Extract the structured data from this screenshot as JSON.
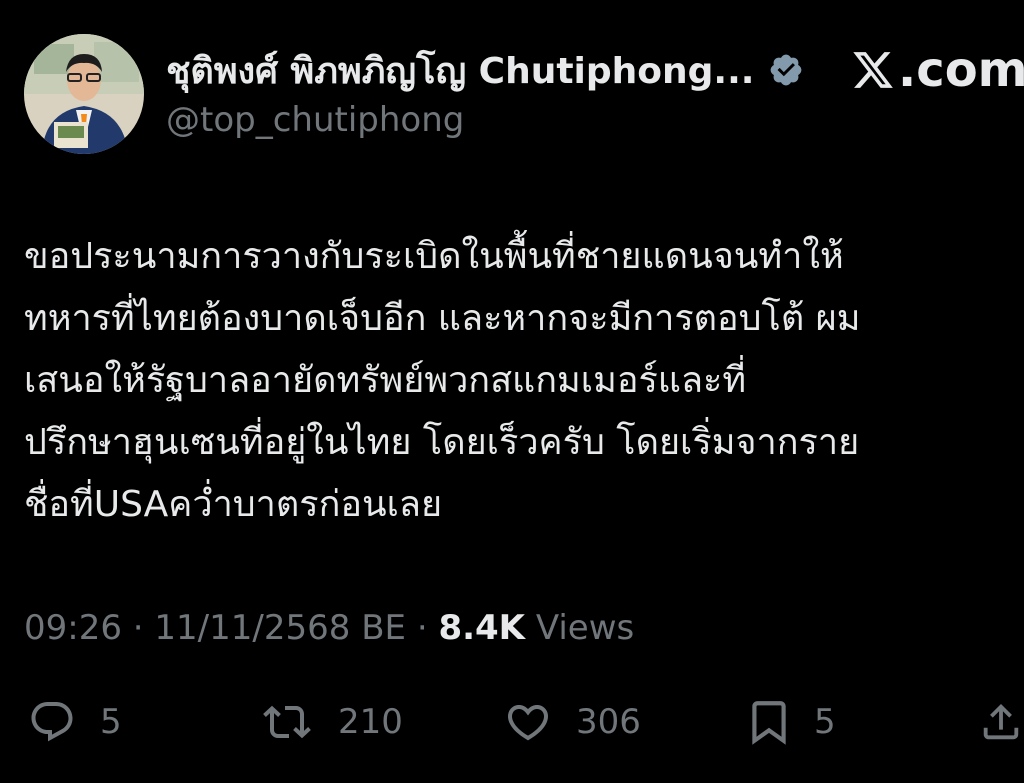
{
  "header": {
    "display_name": "ชุติพงศ์ พิภพภิญโญ Chutiphong...",
    "handle": "@top_chutiphong",
    "site_label": ".com"
  },
  "tweet": {
    "text": "ขอประนามการวางกับระเบิดในพื้นที่ชายแดนจนทำให้\nทหารที่ไทยต้องบาดเจ็บอีก และหากจะมีการตอบโต้ ผม\nเสนอให้รัฐบาลอายัดทรัพย์พวกสแกมเมอร์และที่\nปรึกษาฮุนเซนที่อยู่ในไทย โดยเร็วครับ โดยเริ่มจากราย\nชื่อที่USAคว่ำบาตรก่อนเลย",
    "time": "09:26",
    "sep1": " · ",
    "date": "11/11/2568 BE",
    "sep2": " · ",
    "views_count": "8.4K",
    "views_label": " Views"
  },
  "actions": {
    "replies": "5",
    "reposts": "210",
    "likes": "306",
    "bookmarks": "5"
  },
  "icons": {
    "verified": "verified-badge-icon",
    "x_logo": "x-logo-icon",
    "reply": "reply-icon",
    "repost": "repost-icon",
    "like": "heart-icon",
    "bookmark": "bookmark-icon",
    "share": "share-icon"
  },
  "colors": {
    "background": "#000000",
    "text_primary": "#e7e9ea",
    "text_secondary": "#71767b",
    "verified": "#829aab"
  }
}
